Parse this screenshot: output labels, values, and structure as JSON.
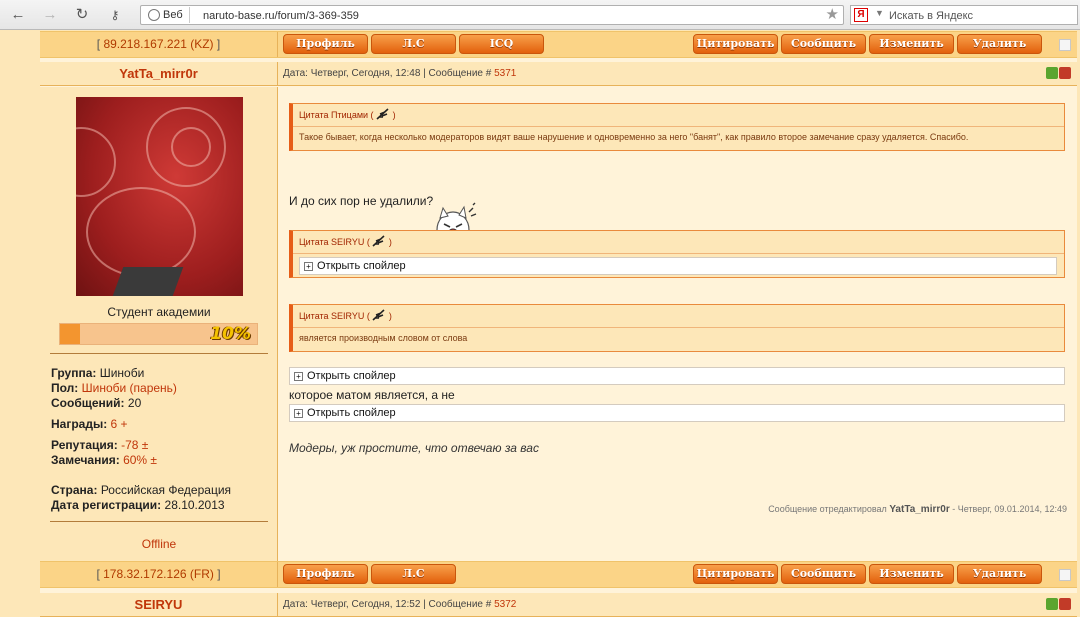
{
  "browser": {
    "site_label": "Веб",
    "url": "naruto-base.ru/forum/3-369-359",
    "search_placeholder": "Искать в Яндекс",
    "search_engine_logo": "Я"
  },
  "top_bar": {
    "ip_open": "[ ",
    "ip": "89.218.167.221 (KZ)",
    "ip_close": " ]",
    "buttons": [
      "Профиль",
      "Л.С",
      "ICQ"
    ],
    "right_buttons": [
      "Цитировать",
      "Сообщить",
      "Изменить",
      "Удалить"
    ]
  },
  "post1": {
    "nick": "YatTa_mirr0r",
    "meta_prefix": "Дата: Четверг, Сегодня, 12:48 | Сообщение # ",
    "number": "5371",
    "rank": "Студент академии",
    "rank_progress": 10,
    "rank_progress_label": "10%",
    "info": {
      "group_label": "Группа:",
      "group": "Шиноби",
      "gender_label": "Пол:",
      "gender": "Шиноби (парень)",
      "posts_label": "Сообщений:",
      "posts": "20",
      "awards_label": "Награды:",
      "awards": "6  +",
      "reputation_label": "Репутация:",
      "reputation": "-78  ±",
      "warnings_label": "Замечания:",
      "warnings": "60%  ±",
      "country_label": "Страна:",
      "country": "Российская Федерация",
      "regdate_label": "Дата регистрации:",
      "regdate": "28.10.2013"
    },
    "status": "Offline",
    "quotes": [
      {
        "author": "Цитата Птицами (",
        "close": ")",
        "text": "Такое бывает, когда несколько модераторов видят ваше нарушение и одновременно за него \"банят\", как правило второе замечание сразу удаляется. Спасибо."
      },
      {
        "author": "Цитата SEIRYU (",
        "close": ")",
        "spoiler": "Открыть спойлер"
      },
      {
        "author": "Цитата SEIRYU (",
        "close": ")",
        "text": "является производным словом от слова"
      }
    ],
    "text1": "И до сих пор не удалили?",
    "spoiler1": "Открыть спойлер",
    "text2": "которое матом является, а не",
    "spoiler2": "Открыть спойлер",
    "text3": "Модеры, уж простите, что отвечаю за вас",
    "edit_prefix": "Сообщение отредактировал ",
    "edit_nick": "YatTa_mirr0r",
    "edit_suffix": " - Четверг, 09.01.2014, 12:49"
  },
  "bottom_bar": {
    "ip_open": "[ ",
    "ip": "178.32.172.126 (FR)",
    "ip_close": " ]",
    "buttons": [
      "Профиль",
      "Л.С"
    ],
    "right_buttons": [
      "Цитировать",
      "Сообщить",
      "Изменить",
      "Удалить"
    ]
  },
  "post2": {
    "nick": "SEIRYU",
    "meta_prefix": "Дата: Четверг, Сегодня, 12:52 | Сообщение # ",
    "number": "5372"
  },
  "colors": {
    "accent": "#e2600c",
    "nick": "#c0360a",
    "panel": "#fde7b8"
  }
}
